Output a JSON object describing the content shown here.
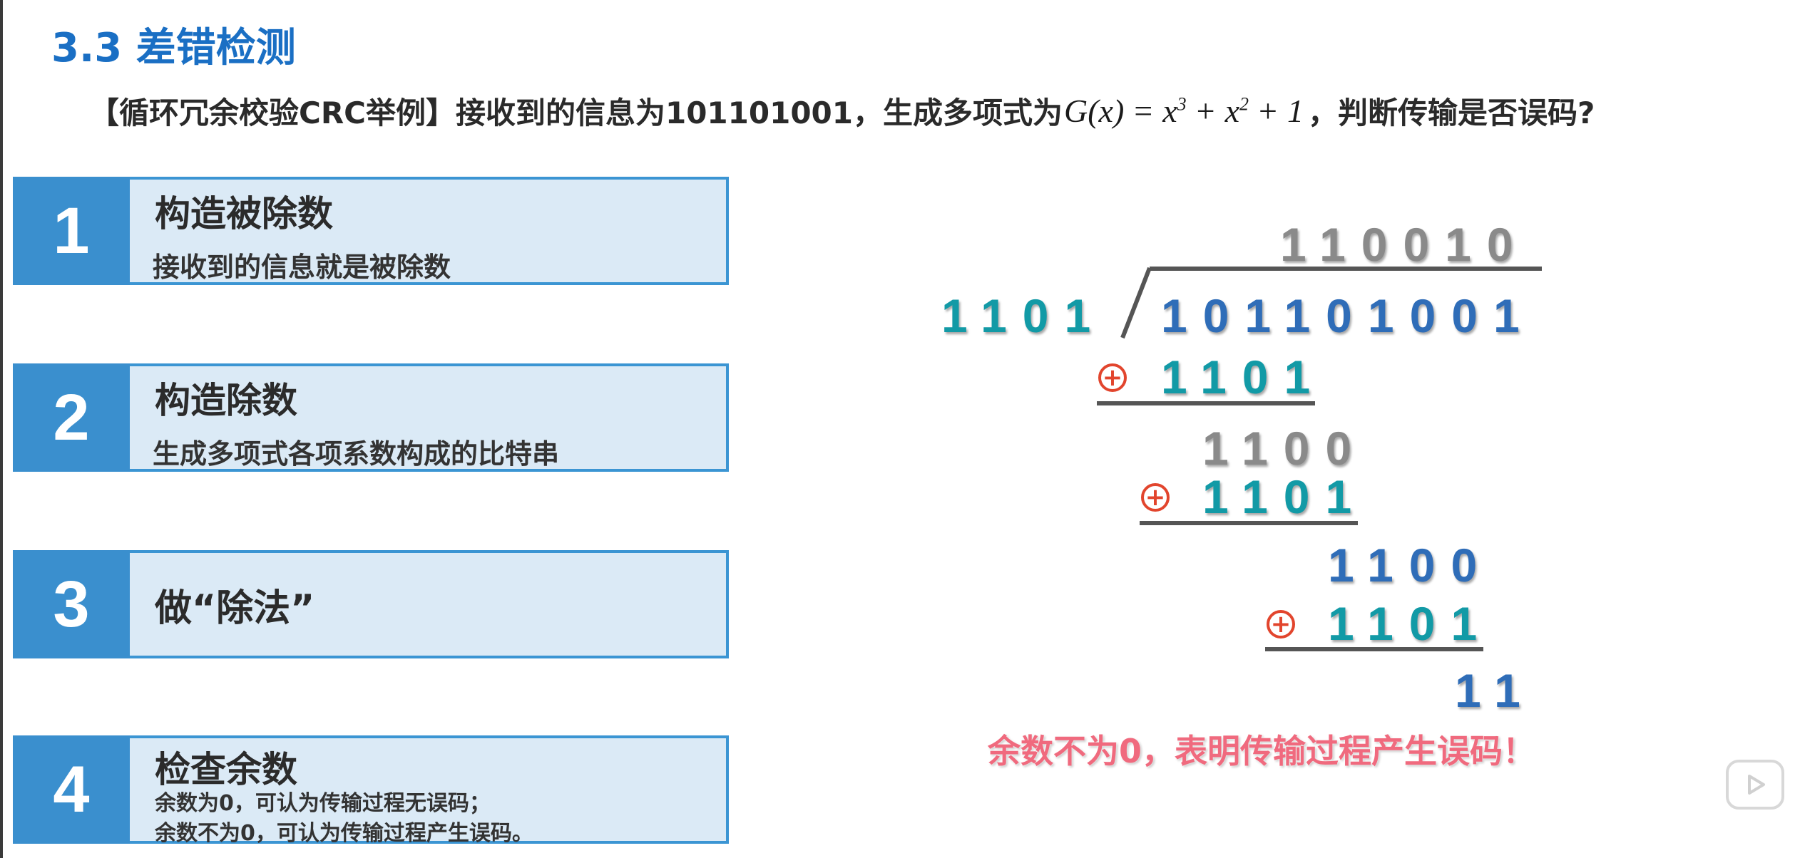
{
  "section_title": "3.3 差错检测",
  "question": {
    "prefix": "【循环冗余校验CRC举例】接收到的信息为101101001，生成多项式为",
    "formula": {
      "lhs": "G(x)",
      "eq": "=",
      "t1": "x",
      "t1_exp": "3",
      "plus1": "+",
      "t2": "x",
      "t2_exp": "2",
      "plus2": "+",
      "t3": "1"
    },
    "suffix": "，判断传输是否误码?"
  },
  "steps": [
    {
      "number": "1",
      "title": "构造被除数",
      "subtitle": "接收到的信息就是被除数"
    },
    {
      "number": "2",
      "title": "构造除数",
      "subtitle": "生成多项式各项系数构成的比特串"
    },
    {
      "number": "3",
      "title": "做“除法”"
    },
    {
      "number": "4",
      "title": "检查余数",
      "lines": [
        "余数为0，可认为传输过程无误码；",
        "余数不为0，可认为传输过程产生误码。"
      ]
    }
  ],
  "division": {
    "quotient": "110010",
    "divisor": "1101",
    "dividend": "101101001",
    "xor_symbol": "+",
    "rows": [
      {
        "id": "sub1",
        "value": "1101"
      },
      {
        "id": "rem1",
        "value": "1100"
      },
      {
        "id": "sub2",
        "value": "1101"
      },
      {
        "id": "rem2",
        "value": "1100"
      },
      {
        "id": "sub3",
        "value": "1101"
      },
      {
        "id": "remainder",
        "value": "11"
      }
    ],
    "conclusion": "余数不为0，表明传输过程产生误码！"
  },
  "colors": {
    "title_blue": "#1a6fc4",
    "card_border": "#3b95d3",
    "card_bg": "#dbeaf6",
    "number_bg": "#3a8fce",
    "digit_gray": "#8a8a8a",
    "digit_teal": "#129aa6",
    "digit_blue": "#2f6db8",
    "xor_red": "#e2452d",
    "conclusion_pink": "#f06a7e"
  },
  "icons": {
    "xor": "circled-plus-icon",
    "player": "play-icon"
  }
}
